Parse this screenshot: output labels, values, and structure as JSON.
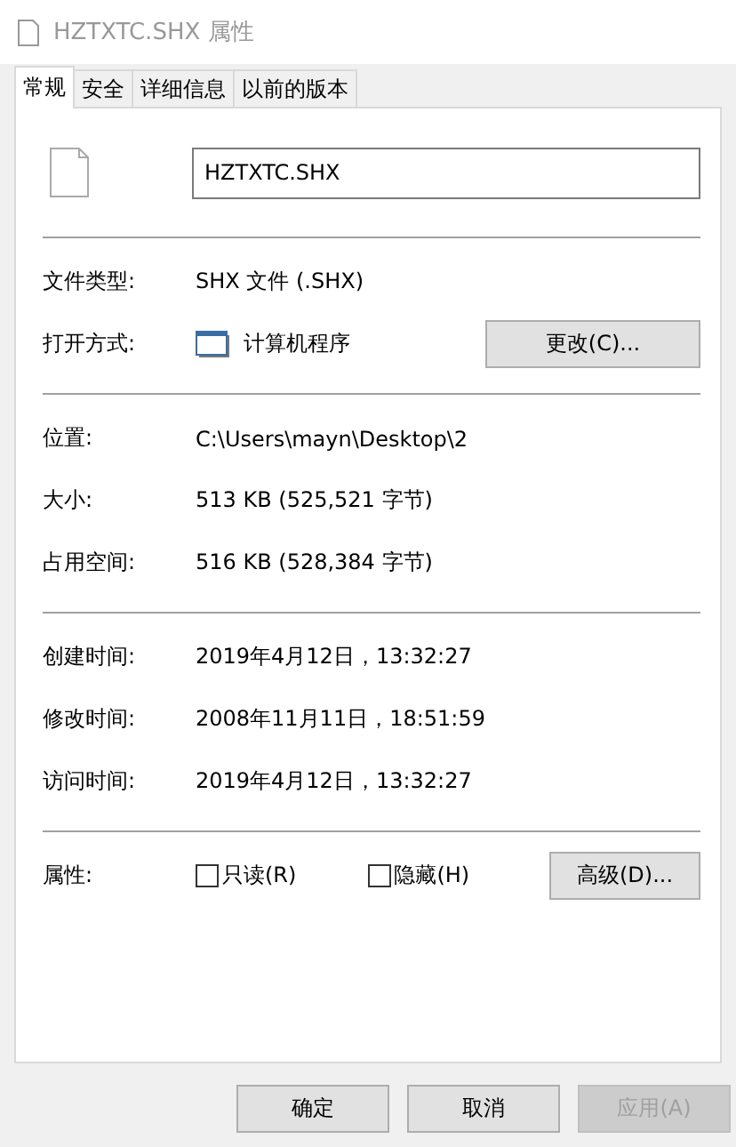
{
  "window": {
    "title": "HZTXTC.SHX 属性"
  },
  "tabs": [
    {
      "label": "常规",
      "selected": true
    },
    {
      "label": "安全",
      "selected": false
    },
    {
      "label": "详细信息",
      "selected": false
    },
    {
      "label": "以前的版本",
      "selected": false
    }
  ],
  "file_name": "HZTXTC.SHX",
  "sections": [
    [
      {
        "kind": "text",
        "label": "文件类型:",
        "value": "SHX 文件 (.SHX)"
      },
      {
        "kind": "program",
        "label": "打开方式:",
        "value": "计算机程序",
        "button": "更改(C)..."
      }
    ],
    [
      {
        "kind": "text",
        "label": "位置:",
        "value": "C:\\Users\\mayn\\Desktop\\2"
      },
      {
        "kind": "text",
        "label": "大小:",
        "value": "513 KB (525,521 字节)"
      },
      {
        "kind": "text",
        "label": "占用空间:",
        "value": "516 KB (528,384 字节)"
      }
    ],
    [
      {
        "kind": "text",
        "label": "创建时间:",
        "value": "2019年4月12日，13:32:27"
      },
      {
        "kind": "text",
        "label": "修改时间:",
        "value": "2008年11月11日，18:51:59"
      },
      {
        "kind": "text",
        "label": "访问时间:",
        "value": "2019年4月12日，13:32:27"
      }
    ],
    [
      {
        "kind": "attributes",
        "label": "属性:",
        "checkboxes": [
          {
            "label": "只读(R)",
            "checked": false
          },
          {
            "label": "隐藏(H)",
            "checked": false
          }
        ],
        "button": "高级(D)..."
      }
    ]
  ],
  "buttons": [
    {
      "label": "确定",
      "disabled": false
    },
    {
      "label": "取消",
      "disabled": false
    },
    {
      "label": "应用(A)",
      "disabled": true
    }
  ]
}
